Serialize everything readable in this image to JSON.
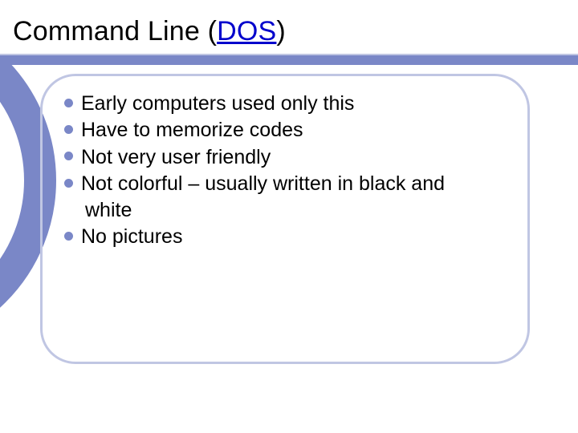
{
  "title": {
    "pre": "Command Line (",
    "link": "DOS",
    "post": ")"
  },
  "items": [
    {
      "text": "Early computers used only this"
    },
    {
      "text": "Have to memorize codes"
    },
    {
      "text": "Not very user friendly"
    },
    {
      "text": "Not colorful – usually written in black and",
      "cont": "white"
    },
    {
      "text": "No pictures"
    }
  ]
}
